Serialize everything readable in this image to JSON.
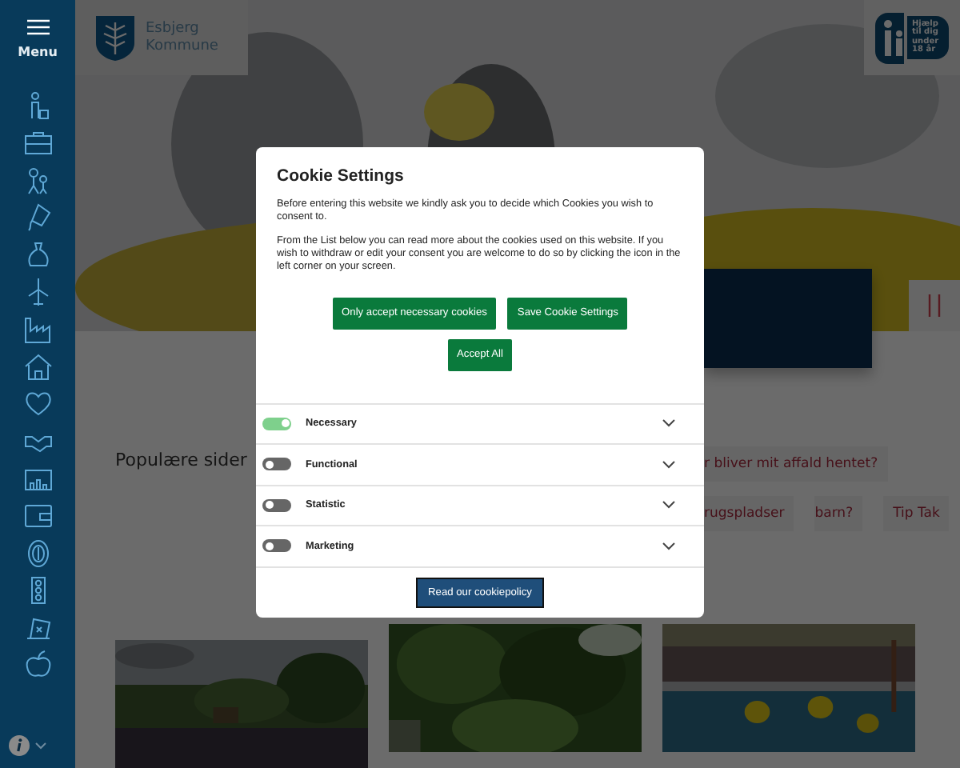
{
  "sidebar": {
    "menu_label": "Menu"
  },
  "header": {
    "logo_text": "Esbjerg Kommune",
    "help_badge": "Hjælp til dig under 18 år"
  },
  "popular": {
    "heading": "Populære sider",
    "links": [
      "r bliver mit affald hentet?",
      "rugspladser",
      "barn?",
      "Tip Tak"
    ]
  },
  "cookie_dialog": {
    "title": "Cookie Settings",
    "paragraphs": [
      "Before entering this website we kindly ask you to decide which Cookies you wish to consent to.",
      "From the List below you can read more about the cookies used on this website. If you wish to withdraw or edit your consent you are welcome to do so by clicking the icon in the left corner on your screen."
    ],
    "buttons": [
      "Only accept necessary cookies",
      "Save Cookie Settings",
      "Accept All"
    ],
    "categories": [
      {
        "label": "Necessary",
        "on": true
      },
      {
        "label": "Functional",
        "on": false
      },
      {
        "label": "Statistic",
        "on": false
      },
      {
        "label": "Marketing",
        "on": false
      }
    ],
    "policy_button": "Read our cookiepolicy"
  }
}
